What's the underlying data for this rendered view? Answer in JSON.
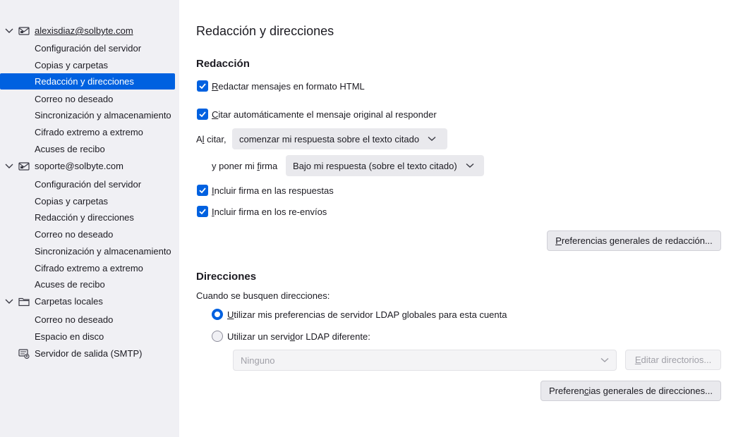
{
  "sidebar": {
    "accounts": [
      {
        "label": "alexisdiaz@solbyte.com",
        "icon": "mail-account-icon",
        "items": [
          {
            "label": "Configuración del servidor"
          },
          {
            "label": "Copias y carpetas"
          },
          {
            "label": "Redacción y direcciones",
            "selected": true
          },
          {
            "label": "Correo no deseado"
          },
          {
            "label": "Sincronización y almacenamiento"
          },
          {
            "label": "Cifrado extremo a extremo"
          },
          {
            "label": "Acuses de recibo"
          }
        ]
      },
      {
        "label": "soporte@solbyte.com",
        "icon": "mail-account-icon",
        "items": [
          {
            "label": "Configuración del servidor"
          },
          {
            "label": "Copias y carpetas"
          },
          {
            "label": "Redacción y direcciones"
          },
          {
            "label": "Correo no deseado"
          },
          {
            "label": "Sincronización y almacenamiento"
          },
          {
            "label": "Cifrado extremo a extremo"
          },
          {
            "label": "Acuses de recibo"
          }
        ]
      },
      {
        "label": "Carpetas locales",
        "icon": "folder-icon",
        "items": [
          {
            "label": "Correo no deseado"
          },
          {
            "label": "Espacio en disco"
          }
        ]
      }
    ],
    "smtp": {
      "label": "Servidor de salida (SMTP)",
      "icon": "outgoing-server-icon"
    }
  },
  "main": {
    "title": "Redacción y direcciones",
    "composition": {
      "heading": "Redacción",
      "html_format": {
        "label_ak": "R",
        "label_rest": "edactar mensajes en formato HTML",
        "checked": true
      },
      "auto_quote": {
        "label_ak": "C",
        "label_rest": "itar automáticamente el mensaje original al responder",
        "checked": true
      },
      "when_quoting": {
        "label_pre": "A",
        "label_ak": "l",
        "label_post": " citar,",
        "value": "comenzar mi respuesta sobre el texto citado"
      },
      "signature_place": {
        "label_pre": "y poner mi ",
        "label_ak": "f",
        "label_post": "irma",
        "value": "Bajo mi respuesta (sobre el texto citado)"
      },
      "sig_reply": {
        "label_ak": "I",
        "label_rest": "ncluir firma en las respuestas",
        "checked": true
      },
      "sig_forward": {
        "label_ak": "I",
        "label_rest": "ncluir firma en los re-envíos",
        "checked": true
      },
      "global_prefs_button": {
        "label_ak": "P",
        "label_rest": "referencias generales de redacción..."
      }
    },
    "addressing": {
      "heading": "Direcciones",
      "intro": "Cuando se busquen direcciones:",
      "use_global": {
        "label_ak": "U",
        "label_rest": "tilizar mis preferencias de servidor LDAP globales para esta cuenta",
        "selected": true
      },
      "use_different": {
        "label_pre": "Utilizar un servi",
        "label_ak": "d",
        "label_post": "or LDAP diferente:",
        "selected": false
      },
      "ldap_select": {
        "value": "Ninguno",
        "disabled": true
      },
      "edit_dirs_button": {
        "label_ak": "E",
        "label_rest": "ditar directorios...",
        "disabled": true
      },
      "global_prefs_button": {
        "label_pre": "Preferen",
        "label_ak": "c",
        "label_post": "ias generales de direcciones..."
      }
    }
  }
}
